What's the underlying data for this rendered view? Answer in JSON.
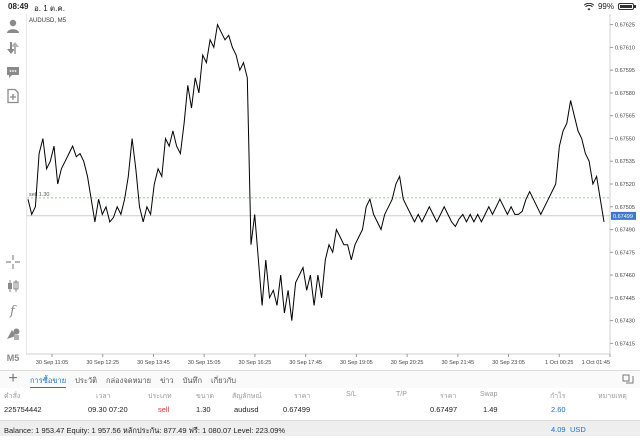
{
  "status_bar": {
    "time": "08:49",
    "date": "อ. 1 ต.ค.",
    "battery": "99%"
  },
  "toolbar": {
    "timeframe_label": "M5"
  },
  "chart": {
    "symbol_label": "AUDUSD, M5",
    "order_line_label": "sell 1.30",
    "current_price_label": "0.67499",
    "colors": {
      "line": "#000000",
      "order_line": "#7ab87a",
      "price_tag": "#3f78c9"
    }
  },
  "chart_data": {
    "type": "line",
    "title": "AUDUSD, M5",
    "y_ticks": [
      "0.67625",
      "0.67610",
      "0.67595",
      "0.67580",
      "0.67565",
      "0.67550",
      "0.67535",
      "0.67520",
      "0.67505",
      "0.67490",
      "0.67475",
      "0.67460",
      "0.67445",
      "0.67430",
      "0.67415"
    ],
    "x_ticks": [
      "30 Sep 11:05",
      "30 Sep 12:25",
      "30 Sep 13:45",
      "30 Sep 15:05",
      "30 Sep 16:25",
      "30 Sep 17:45",
      "30 Sep 19:05",
      "30 Sep 20:25",
      "30 Sep 21:45",
      "30 Sep 23:05",
      "1 Oct 00:25",
      "1 Oct 01:45"
    ],
    "ylim": [
      0.67408,
      0.67632
    ],
    "order_price": 0.67499,
    "current_price": 0.67499,
    "values": [
      0.6751,
      0.675,
      0.67505,
      0.6754,
      0.6755,
      0.6753,
      0.67535,
      0.67545,
      0.6752,
      0.6753,
      0.67535,
      0.6754,
      0.67545,
      0.67538,
      0.6754,
      0.67535,
      0.67525,
      0.6751,
      0.67495,
      0.6751,
      0.675,
      0.67505,
      0.67495,
      0.67498,
      0.67505,
      0.675,
      0.6751,
      0.67525,
      0.6755,
      0.6753,
      0.67505,
      0.67495,
      0.67505,
      0.675,
      0.6752,
      0.6753,
      0.67525,
      0.6755,
      0.67545,
      0.67555,
      0.67545,
      0.6754,
      0.6756,
      0.67585,
      0.6757,
      0.6759,
      0.6758,
      0.67605,
      0.676,
      0.67615,
      0.6761,
      0.67625,
      0.6762,
      0.67615,
      0.67618,
      0.6761,
      0.67605,
      0.67595,
      0.676,
      0.6759,
      0.6748,
      0.675,
      0.6747,
      0.6744,
      0.6747,
      0.67445,
      0.6745,
      0.6744,
      0.6746,
      0.67435,
      0.6745,
      0.6743,
      0.67455,
      0.6746,
      0.67465,
      0.6745,
      0.6746,
      0.6744,
      0.6746,
      0.67445,
      0.6747,
      0.6748,
      0.67475,
      0.6749,
      0.67485,
      0.6748,
      0.6748,
      0.6747,
      0.6748,
      0.67485,
      0.6749,
      0.67505,
      0.6751,
      0.675,
      0.67495,
      0.6749,
      0.675,
      0.67505,
      0.6751,
      0.6752,
      0.67525,
      0.6751,
      0.67505,
      0.675,
      0.67495,
      0.675,
      0.67495,
      0.675,
      0.67505,
      0.675,
      0.67495,
      0.675,
      0.67505,
      0.675,
      0.67495,
      0.67492,
      0.67497,
      0.675,
      0.67495,
      0.675,
      0.67495,
      0.675,
      0.67495,
      0.675,
      0.67505,
      0.675,
      0.67505,
      0.6751,
      0.67505,
      0.675,
      0.67505,
      0.675,
      0.675,
      0.67502,
      0.6751,
      0.67515,
      0.6751,
      0.67505,
      0.675,
      0.67505,
      0.6751,
      0.67515,
      0.6752,
      0.67545,
      0.67555,
      0.6756,
      0.67575,
      0.67565,
      0.67555,
      0.6755,
      0.6754,
      0.67535,
      0.6752,
      0.67525,
      0.6751,
      0.67495
    ]
  },
  "terminal": {
    "tabs": [
      "การซื้อขาย",
      "ประวัติ",
      "กล่องจดหมาย",
      "ข่าว",
      "บันทึก",
      "เกี่ยวกับ"
    ],
    "columns": [
      "คำสั่ง",
      "เวลา",
      "ประเภท",
      "ขนาด",
      "สัญลักษณ์",
      "ราคา",
      "S/L",
      "T/P",
      "ราคา",
      "Swap",
      "กำไร",
      "หมายเหตุ"
    ],
    "rows": [
      {
        "order": "225754442",
        "time": "09.30 07:20",
        "type": "sell",
        "size": "1.30",
        "symbol": "audusd",
        "open_price": "0.67499",
        "sl": "",
        "tp": "",
        "price": "0.67497",
        "swap": "1.49",
        "profit": "2.60",
        "comment": ""
      }
    ],
    "balance_line": "Balance: 1 953.47 Equity: 1 957.56 หลักประกัน: 877.49 ฟรี: 1 080.07 Level: 223.09%",
    "total_profit": "4.09",
    "currency": "USD"
  }
}
